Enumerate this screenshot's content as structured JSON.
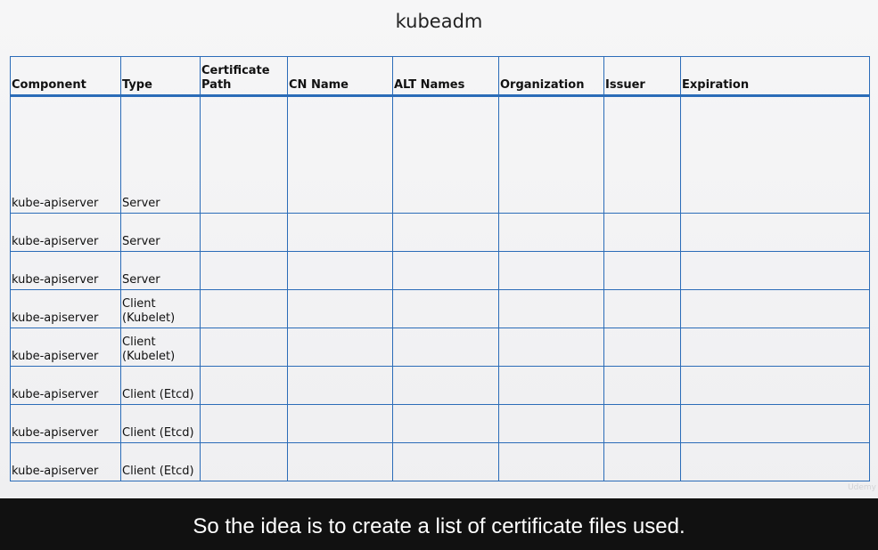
{
  "slide": {
    "title": "kubeadm"
  },
  "table": {
    "headers": [
      "Component",
      "Type",
      "Certificate\nPath",
      "CN Name",
      "ALT Names",
      "Organization",
      "Issuer",
      "Expiration"
    ],
    "rows": [
      [
        "kube-apiserver",
        "Server",
        "",
        "",
        "",
        "",
        "",
        ""
      ],
      [
        "kube-apiserver",
        "Server",
        "",
        "",
        "",
        "",
        "",
        ""
      ],
      [
        "kube-apiserver",
        "Server",
        "",
        "",
        "",
        "",
        "",
        ""
      ],
      [
        "kube-apiserver",
        "Client\n(Kubelet)",
        "",
        "",
        "",
        "",
        "",
        ""
      ],
      [
        "kube-apiserver",
        "Client\n(Kubelet)",
        "",
        "",
        "",
        "",
        "",
        ""
      ],
      [
        "kube-apiserver",
        "Client (Etcd)",
        "",
        "",
        "",
        "",
        "",
        ""
      ],
      [
        "kube-apiserver",
        "Client (Etcd)",
        "",
        "",
        "",
        "",
        "",
        ""
      ],
      [
        "kube-apiserver",
        "Client (Etcd)",
        "",
        "",
        "",
        "",
        "",
        ""
      ]
    ]
  },
  "caption": {
    "text": "So the idea is to create a list of certificate files used."
  },
  "watermark": {
    "text": "Udemy"
  },
  "colors": {
    "table_border": "#2b6cb8",
    "caption_bg": "#111111",
    "caption_text": "#ffffff"
  }
}
